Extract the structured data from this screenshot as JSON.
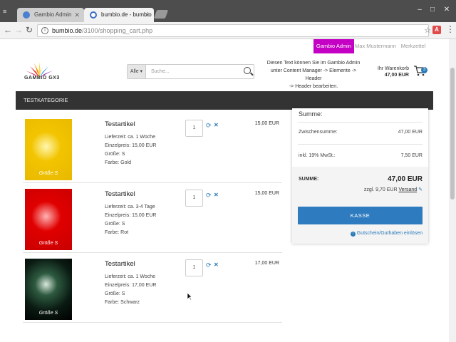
{
  "browser": {
    "tabs": [
      {
        "title": "Gambio Admin",
        "favicon_color": "#4a7fd1"
      },
      {
        "title": "bumbio.de - bumbio",
        "favicon_color": "#3a6fc4"
      }
    ],
    "url_host": "bumbio.de",
    "url_path": "/3100/shopping_cart.php",
    "ext_label": "A"
  },
  "topnav": {
    "admin": "Gambio Admin",
    "user": "Max Mustermann",
    "wishlist": "Merkzettel"
  },
  "header": {
    "logo_text": "GAMBIO GX3",
    "search_category": "Alle",
    "search_placeholder": "Suche...",
    "note_lines": [
      "Diesen Text können Sie im Gambio Admin",
      "unter Content Manager -> Elemente -> Header",
      "-> Header bearbeiten."
    ],
    "cart_label": "Ihr Warenkorb",
    "cart_total": "47,00 EUR",
    "cart_count": "3"
  },
  "category_bar": "TESTKATEGORIE",
  "items": [
    {
      "name": "Testartikel",
      "delivery": "Lieferzeit: ca. 1 Woche",
      "unit_price": "Einzelpreis: 15,00 EUR",
      "size": "Größe: S",
      "color": "Farbe: Gold",
      "qty": "1",
      "price": "15,00 EUR",
      "thumb_label": "Größe S",
      "thumb_color": "#f2c400"
    },
    {
      "name": "Testartikel",
      "delivery": "Lieferzeit: ca. 3-4 Tage",
      "unit_price": "Einzelpreis: 15,00 EUR",
      "size": "Größe: S",
      "color": "Farbe: Rot",
      "qty": "1",
      "price": "15,00 EUR",
      "thumb_label": "Größe S",
      "thumb_color": "#e00000"
    },
    {
      "name": "Testartikel",
      "delivery": "Lieferzeit: ca. 1 Woche",
      "unit_price": "Einzelpreis: 17,00 EUR",
      "size": "Größe: S",
      "color": "Farbe: Schwarz",
      "qty": "1",
      "price": "17,00 EUR",
      "thumb_label": "Größe S",
      "thumb_color": "#0a1a12"
    }
  ],
  "summary": {
    "title": "Summe:",
    "subtotal_label": "Zwischensumme:",
    "subtotal_value": "47,00 EUR",
    "tax_label": "inkl. 19% MwSt.:",
    "tax_value": "7,50 EUR",
    "total_label": "SUMME:",
    "total_value": "47,00 EUR",
    "shipping_prefix": "zzgl. 9,70 EUR",
    "shipping_link": "Versand",
    "checkout_button": "KASSE",
    "voucher_link": "Gutschein/Guthaben einlösen"
  },
  "colors": {
    "admin_accent": "#c300c3",
    "primary_blue": "#2e7bbf",
    "category_bar_bg": "#333333"
  }
}
